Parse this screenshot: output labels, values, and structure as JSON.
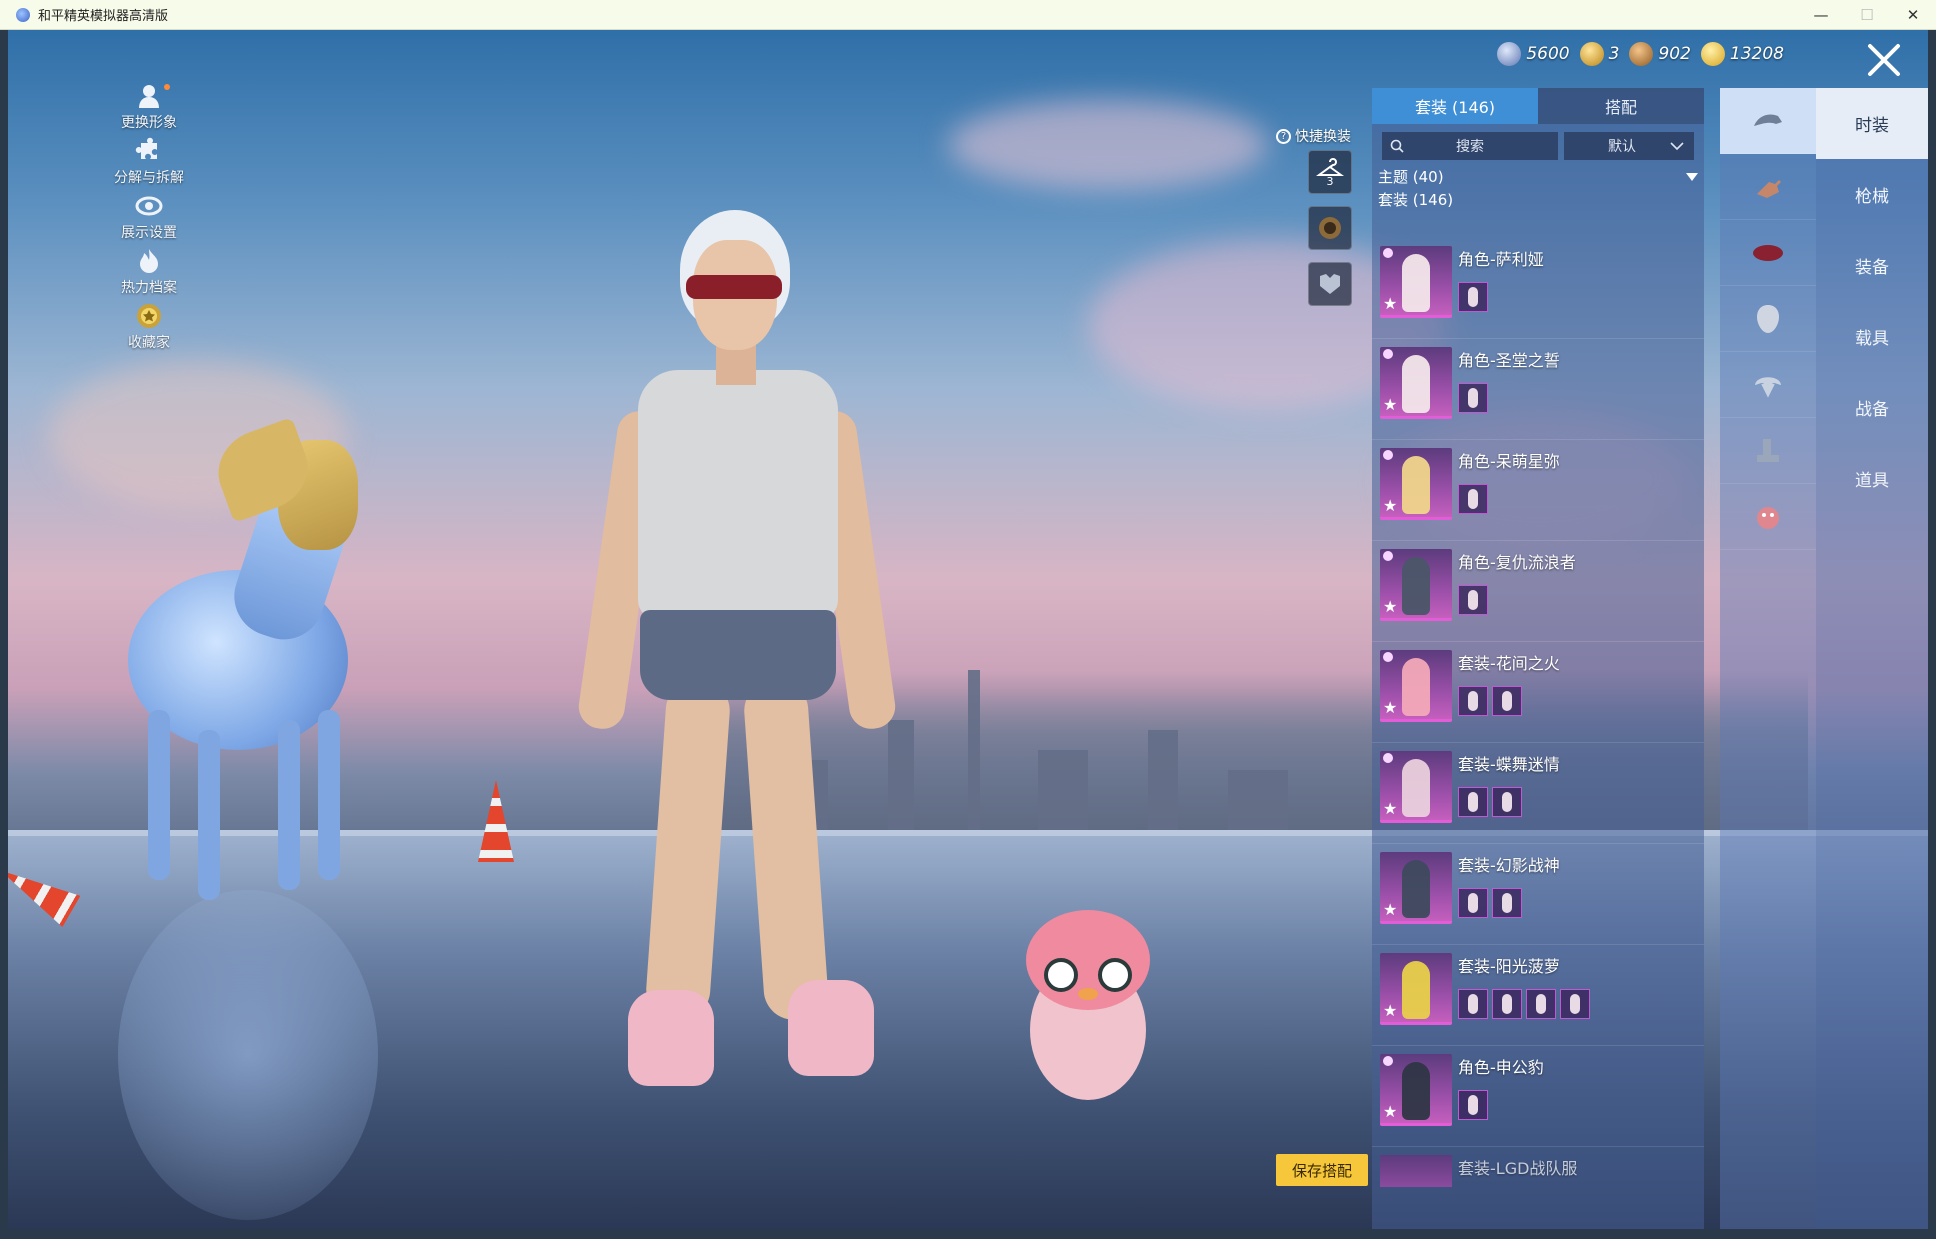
{
  "window": {
    "title": "和平精英模拟器高清版",
    "minimize": "—",
    "maximize": "☐",
    "close": "✕"
  },
  "left_menu": [
    {
      "label": "更换形象",
      "icon": "person-icon"
    },
    {
      "label": "分解与拆解",
      "icon": "puzzle-icon"
    },
    {
      "label": "展示设置",
      "icon": "eye-icon"
    },
    {
      "label": "热力档案",
      "icon": "flame-icon"
    },
    {
      "label": "收藏家",
      "icon": "medal-icon"
    }
  ],
  "currency": [
    {
      "value": "5600",
      "icon": "globe-coin-icon",
      "color": "#7d95c9"
    },
    {
      "value": "3",
      "icon": "gold-token-icon",
      "color": "#d9a82b"
    },
    {
      "value": "902",
      "icon": "bronze-coin-icon",
      "color": "#c9873a"
    },
    {
      "value": "13208",
      "icon": "gold-coin-icon",
      "color": "#f1c43a"
    }
  ],
  "quick_change": {
    "label": "快捷换装",
    "slot_number": "3"
  },
  "outfit_panel": {
    "tabs": [
      {
        "label": "套装 (146)",
        "active": true
      },
      {
        "label": "搭配",
        "active": false
      }
    ],
    "search_placeholder": "搜索",
    "sort_value": "默认",
    "theme_header": "主题 (40)",
    "set_header": "套装 (146)",
    "items": [
      {
        "name": "角色-萨利娅",
        "subs": 1
      },
      {
        "name": "角色-圣堂之誓",
        "subs": 1
      },
      {
        "name": "角色-呆萌星弥",
        "subs": 1
      },
      {
        "name": "角色-复仇流浪者",
        "subs": 1
      },
      {
        "name": "套装-花间之火",
        "subs": 2
      },
      {
        "name": "套装-蝶舞迷情",
        "subs": 2
      },
      {
        "name": "套装-幻影战神",
        "subs": 2
      },
      {
        "name": "套装-阳光菠萝",
        "subs": 4
      },
      {
        "name": "角色-申公豹",
        "subs": 1
      },
      {
        "name": "套装-LGD战队服",
        "subs": 0
      }
    ],
    "save_label": "保存搭配"
  },
  "categories": [
    {
      "label": "时装",
      "icon": "hat-icon",
      "active": true
    },
    {
      "label": "枪械",
      "icon": "gun-icon",
      "active": false
    },
    {
      "label": "装备",
      "icon": "helmet-icon",
      "active": false
    },
    {
      "label": "载具",
      "icon": "mask-icon",
      "active": false
    },
    {
      "label": "战备",
      "icon": "parachute-icon",
      "active": false
    },
    {
      "label": "道具",
      "icon": "boot-icon",
      "active": false
    },
    {
      "label": "",
      "icon": "emote-icon",
      "active": false
    }
  ],
  "colors": {
    "tab_active": "#3f8fd6",
    "save_button": "#f6c63b",
    "rarity_purple": "#e35cd8"
  }
}
